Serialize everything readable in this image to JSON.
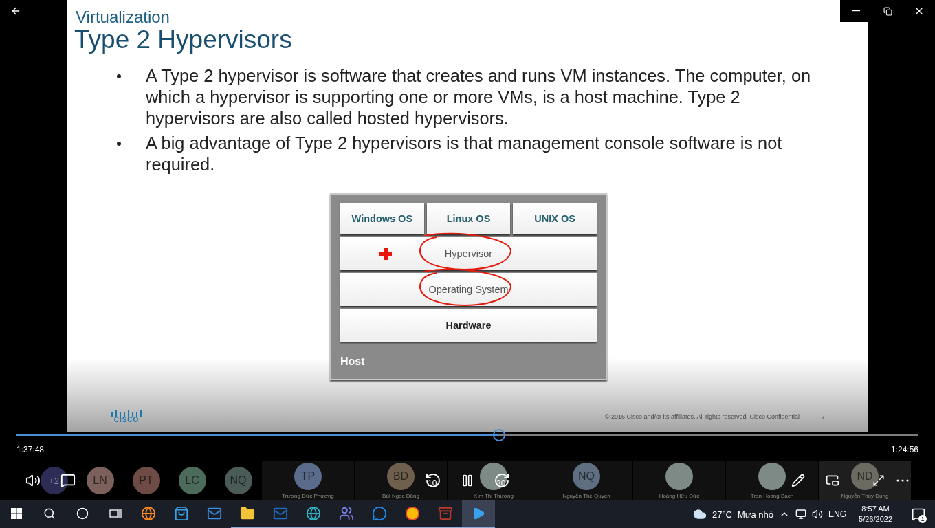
{
  "slide": {
    "section": "Virtualization",
    "title": "Type 2 Hypervisors",
    "bullets": [
      "A Type 2 hypervisor is software that creates and runs VM instances. The computer, on which a hypervisor is supporting one or more VMs, is a host machine. Type 2 hypervisors are also called hosted hypervisors.",
      "A big advantage of Type 2 hypervisors is that management console software is not required."
    ],
    "diagram": {
      "guest_systems": [
        "Windows OS",
        "Linux OS",
        "UNIX OS"
      ],
      "layers": [
        {
          "label": "Hypervisor",
          "circled": true,
          "marked": true,
          "bold": false
        },
        {
          "label": "Operating System",
          "circled": true,
          "marked": false,
          "bold": false
        },
        {
          "label": "Hardware",
          "circled": false,
          "marked": false,
          "bold": true
        }
      ],
      "host_label": "Host"
    },
    "logo_text": "CISCO",
    "footer": "© 2016  Cisco and/or its affiliates. All rights reserved.   Cisco Confidential",
    "page_number": "7"
  },
  "playback": {
    "level": 0.535,
    "elapsed": "1:37:48",
    "remaining": "1:24:56",
    "rewind_label": "10",
    "forward_label": "30"
  },
  "participants": [
    {
      "kind": "overflow",
      "initials": "+2",
      "color": "#2b2d55"
    },
    {
      "kind": "initials",
      "initials": "LN",
      "color": "#7b605b"
    },
    {
      "kind": "initials",
      "initials": "PT",
      "color": "#6f4b45"
    },
    {
      "kind": "initials",
      "initials": "LC",
      "color": "#4d6b5b"
    },
    {
      "kind": "initials",
      "initials": "NQ",
      "color": "#4b5b57"
    },
    {
      "kind": "initials",
      "initials": "TP",
      "name": "Trương Đức Phương",
      "color": "#5b6b8b"
    },
    {
      "kind": "initials",
      "initials": "BD",
      "name": "Bùi Ngọc Dũng",
      "color": "#6f604d"
    },
    {
      "kind": "photo",
      "name": "Kim Thị Thương"
    },
    {
      "kind": "initials",
      "initials": "NQ",
      "name": "Nguyễn Thế Quyền",
      "color": "#5f6f81"
    },
    {
      "kind": "photo",
      "name": "Hoàng Hữu Đức"
    },
    {
      "kind": "photo",
      "name": "Tran Hoang Bach"
    },
    {
      "kind": "initials",
      "initials": "ND",
      "name": "Nguyễn Thùy Dung",
      "color": "#6b6b61",
      "selected": true
    }
  ],
  "taskbar": {
    "apps": [
      {
        "kind": "browser-orange",
        "selected": false,
        "running": false
      },
      {
        "kind": "store",
        "selected": false,
        "running": false
      },
      {
        "kind": "mail",
        "selected": false,
        "running": false
      },
      {
        "kind": "folder",
        "selected": false,
        "running": true
      },
      {
        "kind": "mail-blue",
        "selected": false,
        "running": true
      },
      {
        "kind": "browser-blue",
        "selected": false,
        "running": true
      },
      {
        "kind": "team",
        "selected": false,
        "running": true
      },
      {
        "kind": "chat",
        "selected": false,
        "running": true
      },
      {
        "kind": "browser-round",
        "selected": false,
        "running": true
      },
      {
        "kind": "archive",
        "selected": false,
        "running": true
      },
      {
        "kind": "player",
        "selected": true,
        "running": true
      }
    ],
    "temperature": "27°C",
    "weather": "Mưa nhỏ",
    "language": "ENG",
    "time": "8:57 AM",
    "date": "5/26/2022",
    "notifications": "1"
  }
}
